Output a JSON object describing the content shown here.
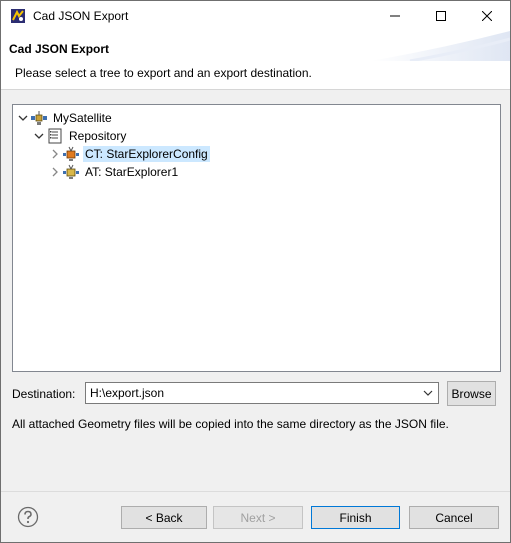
{
  "window": {
    "title": "Cad JSON Export",
    "icons": {
      "app": "eclipse-app-icon",
      "minimize": "minimize-icon",
      "maximize": "maximize-icon",
      "close": "close-icon"
    }
  },
  "header": {
    "title": "Cad JSON Export",
    "description": "Please select a tree to export and an export destination."
  },
  "tree": {
    "items": [
      {
        "label": "MySatellite",
        "icon": "satellite-icon",
        "expanded": true,
        "level": 0
      },
      {
        "label": "Repository",
        "icon": "repository-icon",
        "expanded": true,
        "level": 1
      },
      {
        "label": "CT: StarExplorerConfig",
        "icon": "config-tree-icon",
        "expanded": false,
        "level": 2,
        "selected": true
      },
      {
        "label": "AT: StarExplorer1",
        "icon": "assembly-tree-icon",
        "expanded": false,
        "level": 2
      }
    ]
  },
  "destination": {
    "label": "Destination:",
    "value": "H:\\export.json",
    "browse_label": "Browse"
  },
  "note": "All attached Geometry files will be copied into the same directory as the JSON file.",
  "buttons": {
    "back": "< Back",
    "next": "Next >",
    "finish": "Finish",
    "cancel": "Cancel"
  },
  "colors": {
    "selection": "#cce8ff",
    "default_button_border": "#0078d7",
    "dialog_background": "#f0f0f0"
  }
}
